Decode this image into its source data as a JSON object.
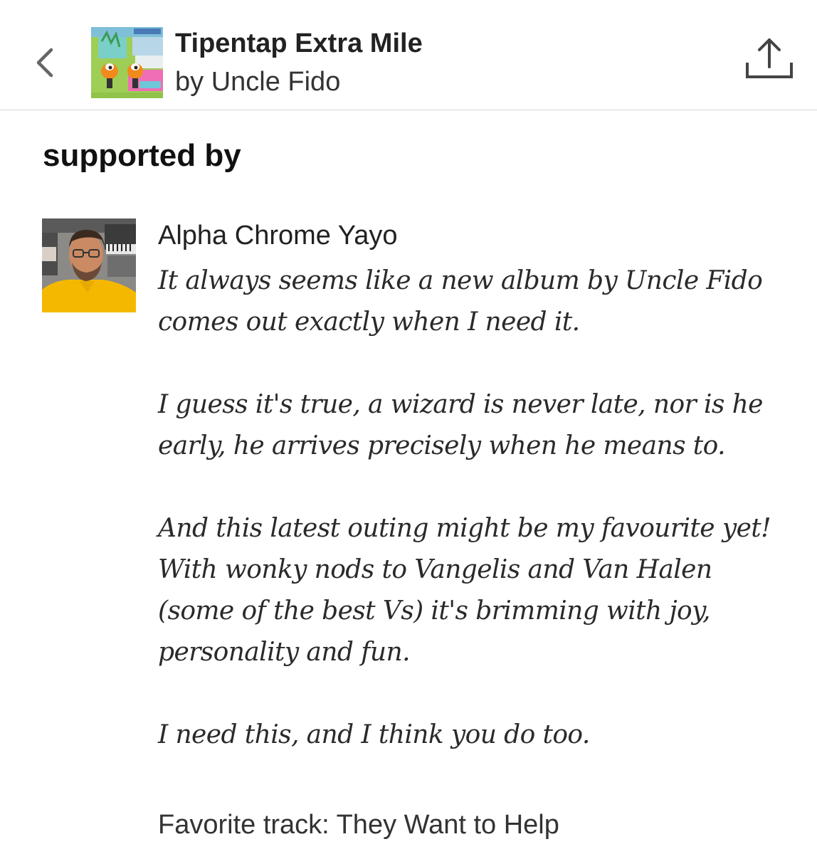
{
  "header": {
    "album_title": "Tipentap Extra Mile",
    "album_artist": "by Uncle Fido",
    "back_icon": "chevron-left-icon",
    "share_icon": "share-icon"
  },
  "section": {
    "heading": "supported by"
  },
  "supporter": {
    "name": "Alpha Chrome Yayo",
    "review_paragraphs": [
      "It always seems like a new album by Uncle Fido comes out exactly when I need it.",
      "I guess it's true, a wizard is never late, nor is he early, he arrives precisely when he means to.",
      "And this latest outing might be my favourite yet! With wonky nods to Vangelis and Van Halen (some of the best Vs) it's brimming with joy, personality and fun.",
      "I need this, and I think you do too."
    ],
    "favorite_track": "Favorite track: They Want to Help"
  },
  "colors": {
    "text": "#222222",
    "divider": "#d4d4d4",
    "avatar_shirt": "#f5b800"
  }
}
